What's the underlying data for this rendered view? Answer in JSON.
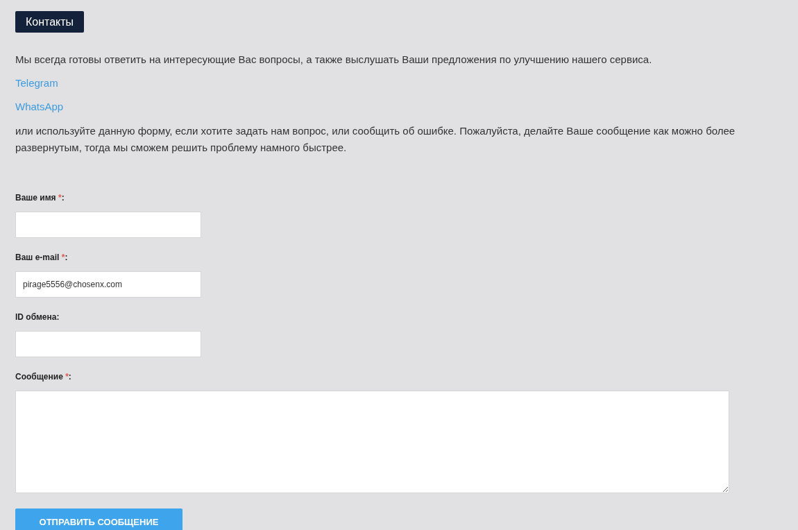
{
  "heading": "Контакты",
  "intro": "Мы всегда готовы ответить на интересующие Вас вопросы, а также выслушать Ваши предложения по улучшению нашего сервиса.",
  "links": [
    "Telegram",
    "WhatsApp"
  ],
  "note": "или используйте данную форму, если хотите задать нам вопрос, или сообщить об ошибке. Пожалуйста, делайте Ваше сообщение как можно более развернутым, тогда мы сможем решить проблему намного быстрее.",
  "fields": [
    {
      "kind": "input",
      "label": "Ваше имя",
      "required_mark": "*",
      "colon": ":"
    },
    {
      "kind": "input",
      "label": "Ваш e-mail",
      "required_mark": "*",
      "colon": ":",
      "value": "pirage5556@chosenx.com"
    },
    {
      "kind": "input",
      "label": "ID обмена",
      "colon": ":"
    },
    {
      "kind": "textarea",
      "label": "Сообщение",
      "required_mark": "*",
      "colon": ":"
    }
  ],
  "submit": "ОТПРАВИТЬ СООБЩЕНИЕ"
}
